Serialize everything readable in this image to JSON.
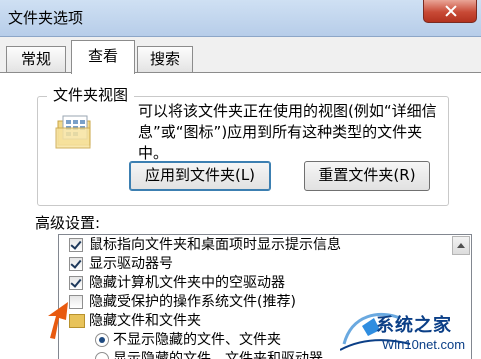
{
  "window": {
    "title": "文件夹选项"
  },
  "tabs": [
    {
      "label": "常规"
    },
    {
      "label": "查看"
    },
    {
      "label": "搜索"
    }
  ],
  "folder_views": {
    "legend": "文件夹视图",
    "description": "可以将该文件夹正在使用的视图(例如“详细信息”或“图标”)应用到所有这种类型的文件夹中。",
    "apply_button": "应用到文件夹(L)",
    "reset_button": "重置文件夹(R)"
  },
  "advanced": {
    "label": "高级设置:",
    "items": [
      {
        "label": "鼠标指向文件夹和桌面项时显示提示信息",
        "checked": true
      },
      {
        "label": "显示驱动器号",
        "checked": true
      },
      {
        "label": "隐藏计算机文件夹中的空驱动器",
        "checked": true
      },
      {
        "label": "隐藏受保护的操作系统文件(推荐)",
        "checked": false
      },
      {
        "label": "隐藏文件和文件夹"
      },
      {
        "label": "不显示隐藏的文件、文件夹",
        "selected": true
      },
      {
        "label": "显示隐藏的文件、文件夹和驱动器",
        "selected": false
      }
    ]
  },
  "watermark": {
    "title": "系统之家",
    "url": "Win10net.com"
  },
  "colors": {
    "titlebar": "#c4d7ee",
    "close": "#c84a36",
    "watermark": "#0b3f87",
    "arrow": "#e85a10"
  }
}
